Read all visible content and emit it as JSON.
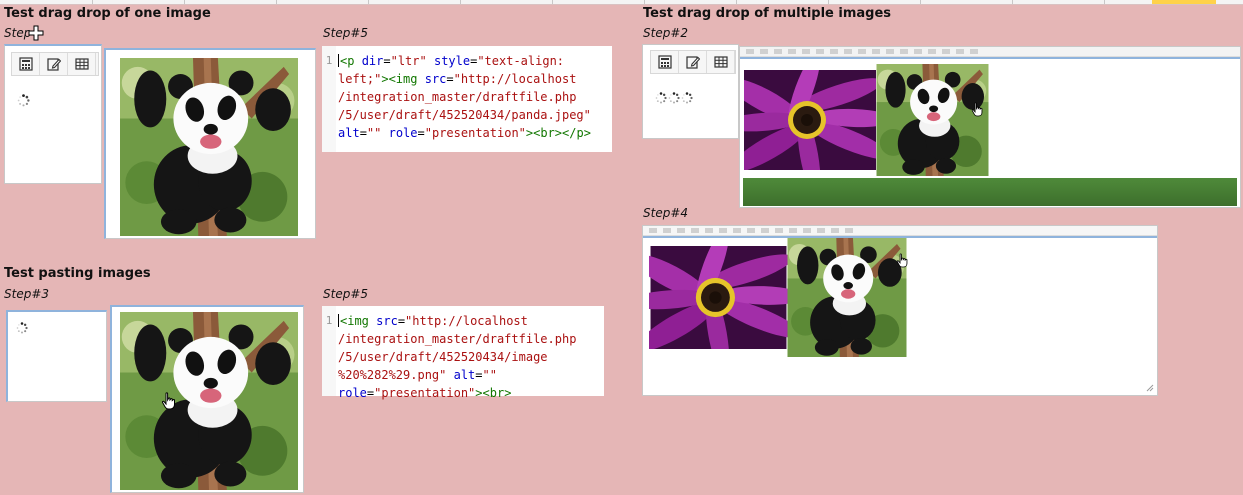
{
  "sections": {
    "one_image": {
      "title": "Test drag drop of one image",
      "step_left": "Step",
      "step_right": "Step#5"
    },
    "pasting": {
      "title": "Test pasting images",
      "step_left": "Step#3",
      "step_right": "Step#5"
    },
    "multiple": {
      "title": "Test drag drop of multiple images",
      "step_top": "Step#2",
      "step_bottom": "Step#4"
    }
  },
  "code_one": {
    "line_number": "1",
    "l1a": "<p ",
    "l1b": "dir",
    "l1c": "=",
    "l1d": "\"ltr\"",
    "l1e": " ",
    "l1f": "style",
    "l1g": "=",
    "l1h": "\"text-align:",
    "l2": "left;\"",
    "l2b": "><img ",
    "l2c": "src",
    "l2d": "=",
    "l2e": "\"http://localhost",
    "l3": "/integration_master/draftfile.php",
    "l4": "/5/user/draft/452520434/panda.jpeg\"",
    "l5a": "alt",
    "l5b": "=",
    "l5c": "\"\"",
    "l5d": " ",
    "l5e": "role",
    "l5f": "=",
    "l5g": "\"presentation\"",
    "l5h": "><br></p>"
  },
  "code_two": {
    "line_number": "1",
    "l1a": "<img ",
    "l1b": "src",
    "l1c": "=",
    "l1d": "\"http://localhost",
    "l2": "/integration_master/draftfile.php",
    "l3": "/5/user/draft/452520434/image",
    "l4a": "%20%282%29.png\"",
    "l4b": " ",
    "l4c": "alt",
    "l4d": "=",
    "l4e": "\"\"",
    "l5a": "role",
    "l5b": "=",
    "l5c": "\"presentation\"",
    "l5d": "><br>"
  },
  "icons": [
    "calculator-icon",
    "edit-icon",
    "table-icon",
    "spinner-icon",
    "hand-cursor-icon",
    "move-cursor-icon"
  ],
  "colors": {
    "background": "#e5b6b6",
    "tag": "#117700",
    "attr": "#0000cc",
    "string": "#a31515",
    "accent_blue": "#8fb3dc"
  }
}
